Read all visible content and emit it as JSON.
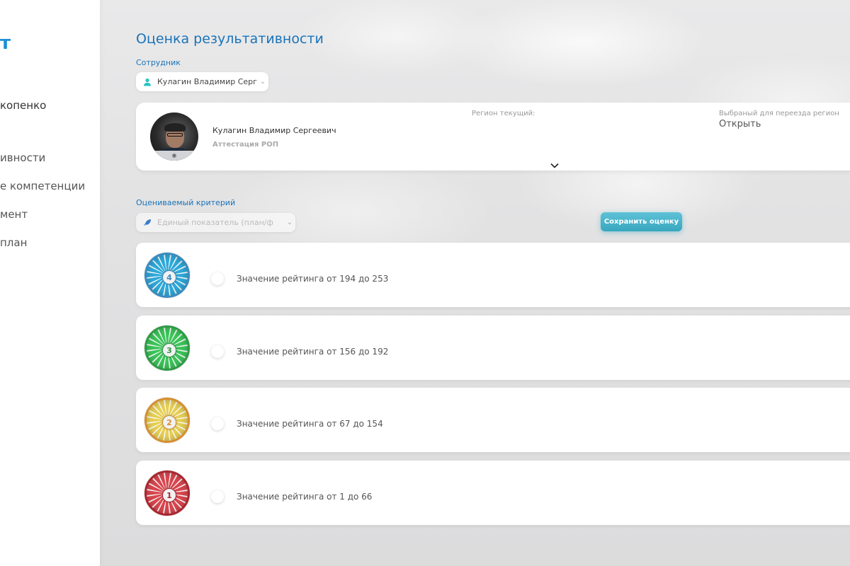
{
  "sidebar": {
    "logo": "т",
    "user": "копенко",
    "items": [
      {
        "label": "ивности"
      },
      {
        "label": "е компетенции"
      },
      {
        "label": "мент"
      },
      {
        "label": "план"
      }
    ]
  },
  "main": {
    "title": "Оценка результативности",
    "employee_label": "Сотрудник",
    "employee_select": "Кулагин Владимир Серге",
    "criterion_label": "Оцениваемый критерий",
    "criterion_select": "Единый показатель (план/ф",
    "save_button": "Сохранить оценку"
  },
  "employee_card": {
    "name": "Кулагин Владимир Сергеевич",
    "role": "Аттестация РОП",
    "region_current_label": "Регион текущий:",
    "region_selected_label": "Выбраный для переезда регион",
    "open_link": "Открыть"
  },
  "ratings": [
    {
      "level": "4",
      "text": "Значение рейтинга от 194 до 253",
      "color": "#2fa9d9",
      "ring": "#3a8bbf"
    },
    {
      "level": "3",
      "text": "Значение рейтинга от 156 до 192",
      "color": "#3cc45a",
      "ring": "#2e9a45"
    },
    {
      "level": "2",
      "text": "Значение рейтинга от 67 до 154",
      "color": "#e6cf56",
      "ring": "#d68e2f"
    },
    {
      "level": "1",
      "text": "Значение рейтинга от 1 до 66",
      "color": "#d8474f",
      "ring": "#a8262e"
    }
  ],
  "icons": {
    "employee": "user-icon",
    "criterion": "rocket-icon",
    "chevron": "chevron-down-icon",
    "camera": "camera-icon"
  }
}
